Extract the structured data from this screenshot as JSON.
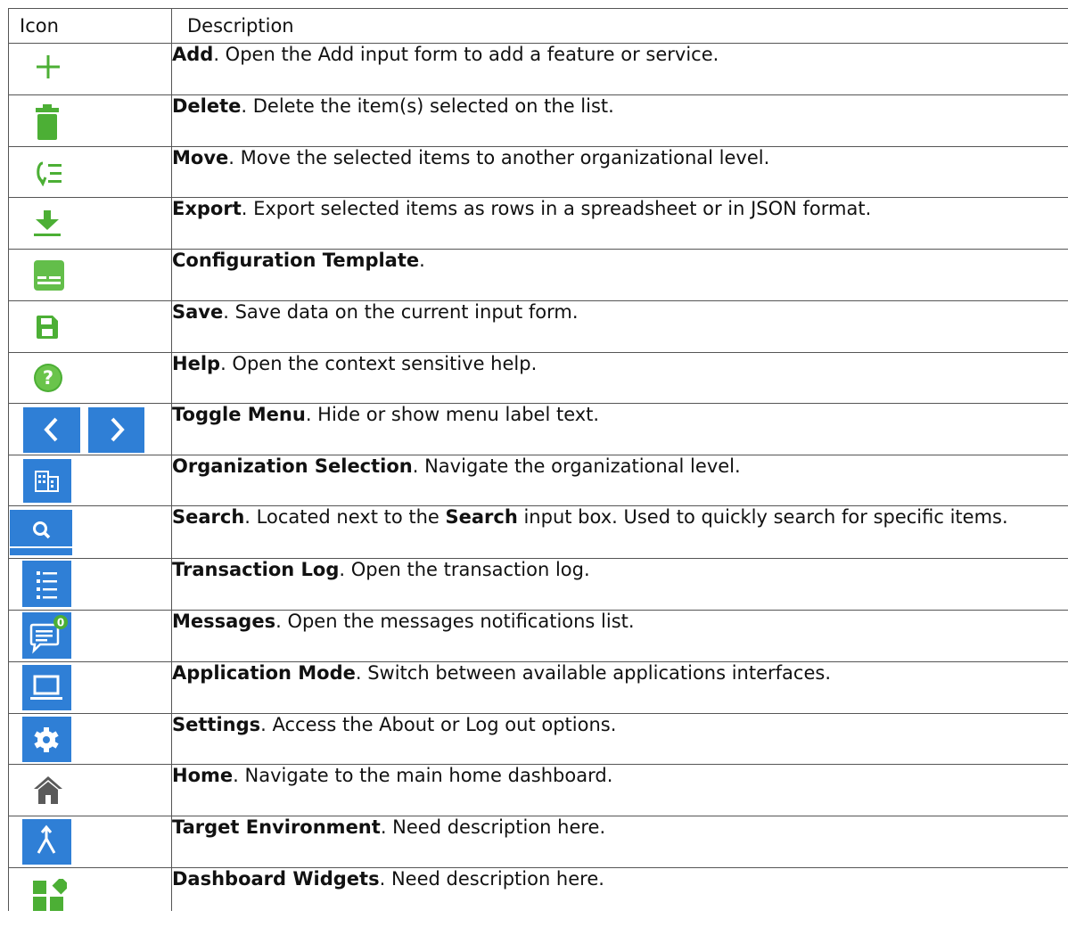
{
  "table": {
    "headers": {
      "icon": "Icon",
      "description": "Description"
    },
    "rows": [
      {
        "icon": "add-icon",
        "name": "Add",
        "text": ". Open the Add input form to add a feature or service."
      },
      {
        "icon": "trash-icon",
        "name": "Delete",
        "text": ". Delete the item(s) selected on the list."
      },
      {
        "icon": "move-icon",
        "name": "Move",
        "text": ". Move the selected items to another organizational level."
      },
      {
        "icon": "download-icon",
        "name": "Export",
        "text": ". Export selected items as rows in a spreadsheet or in JSON format."
      },
      {
        "icon": "template-icon",
        "name": "Configuration Template",
        "text": "."
      },
      {
        "icon": "save-icon",
        "name": "Save",
        "text": ". Save data on the current input form."
      },
      {
        "icon": "help-icon",
        "name": "Help",
        "text": ". Open the context sensitive help."
      },
      {
        "icon": "chevron-left-right-icon",
        "name": "Toggle Menu",
        "text": ". Hide or show menu label text."
      },
      {
        "icon": "organization-icon",
        "name": "Organization Selection",
        "text": ". Navigate the organizational level."
      },
      {
        "icon": "search-icon",
        "name": "Search",
        "text_pre": ". Located next to the ",
        "inline_bold": "Search",
        "text": " input box. Used to quickly search for specific items."
      },
      {
        "icon": "list-icon",
        "name": "Transaction Log",
        "text": ". Open the transaction log."
      },
      {
        "icon": "messages-icon",
        "name": "Messages",
        "text": ". Open the messages notifications list.",
        "badge": "0"
      },
      {
        "icon": "monitor-icon",
        "name": "Application Mode",
        "text": ". Switch between available applications interfaces."
      },
      {
        "icon": "gear-icon",
        "name": "Settings",
        "text": ". Access the About or Log out options."
      },
      {
        "icon": "home-icon",
        "name": "Home",
        "text": ". Navigate to the main home dashboard."
      },
      {
        "icon": "merge-icon",
        "name": "Target Environment",
        "text": ". Need description here."
      },
      {
        "icon": "widgets-icon",
        "name": "Dashboard Widgets",
        "text": ". Need description here."
      }
    ]
  },
  "colors": {
    "green": "#4caf35",
    "blue": "#2f7fd6",
    "home_gray": "#5a5a5a",
    "border": "#555555"
  }
}
